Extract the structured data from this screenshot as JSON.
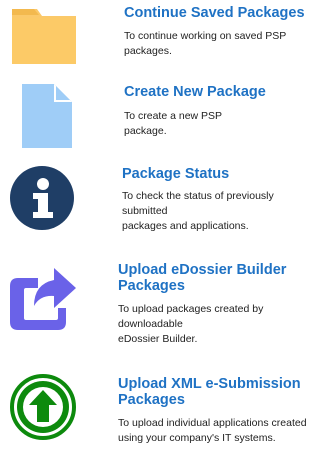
{
  "items": [
    {
      "title": "Continue Saved Packages",
      "description": "To continue working on saved PSP\npackages.",
      "icon": "folder-icon",
      "color": "#fbc96a"
    },
    {
      "title": "Create New Package",
      "description": "To create a new PSP\npackage.",
      "icon": "document-icon",
      "color": "#9fcdf7"
    },
    {
      "title": "Package Status",
      "description": "To check the status of previously\nsubmitted\npackages and applications.",
      "icon": "info-icon",
      "color": "#1f3e66"
    },
    {
      "title": "Upload eDossier Builder\nPackages",
      "description": "To upload packages created by\ndownloadable\neDossier Builder.",
      "icon": "share-icon",
      "color": "#6a62e8"
    },
    {
      "title": "Upload XML e-Submission\nPackages",
      "description": "To upload individual applications created\nusing your company's IT systems.",
      "icon": "upload-arrow-icon",
      "color": "#0d8a0d"
    }
  ]
}
